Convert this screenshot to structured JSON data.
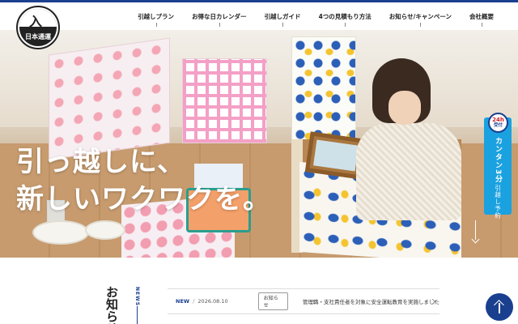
{
  "brand": {
    "logo_glyph": "入",
    "logo_text": "日本通運",
    "accent_color": "#1a3f8f",
    "cta_color": "#1aa1e0"
  },
  "nav": {
    "items": [
      {
        "label": "引越しプラン"
      },
      {
        "label": "お得な日カレンダー"
      },
      {
        "label": "引越しガイド"
      },
      {
        "label": "4つの見積もり方法"
      },
      {
        "label": "お知らせ/キャンペーン"
      },
      {
        "label": "会社概要"
      }
    ]
  },
  "hero": {
    "line1": "引っ越しに、",
    "line2": "新しいワクワクを。"
  },
  "cta": {
    "badge_number": "24h",
    "badge_label": "受付",
    "title": "カンタン3分",
    "subtitle": "引越し予約"
  },
  "news": {
    "eyebrow": "NEWS",
    "heading": "お知らせ/キャンペーン",
    "items": [
      {
        "tag": "NEW",
        "separator": "/",
        "date": "2026.08.10",
        "category": "お知らせ",
        "title": "管理職・支社責任者を対象に安全運転教育を実施しました"
      }
    ]
  },
  "icons": {
    "page_top": "arrow-up-icon",
    "news_arrow": "chevron-right-icon",
    "scroll": "arrow-down-icon"
  }
}
